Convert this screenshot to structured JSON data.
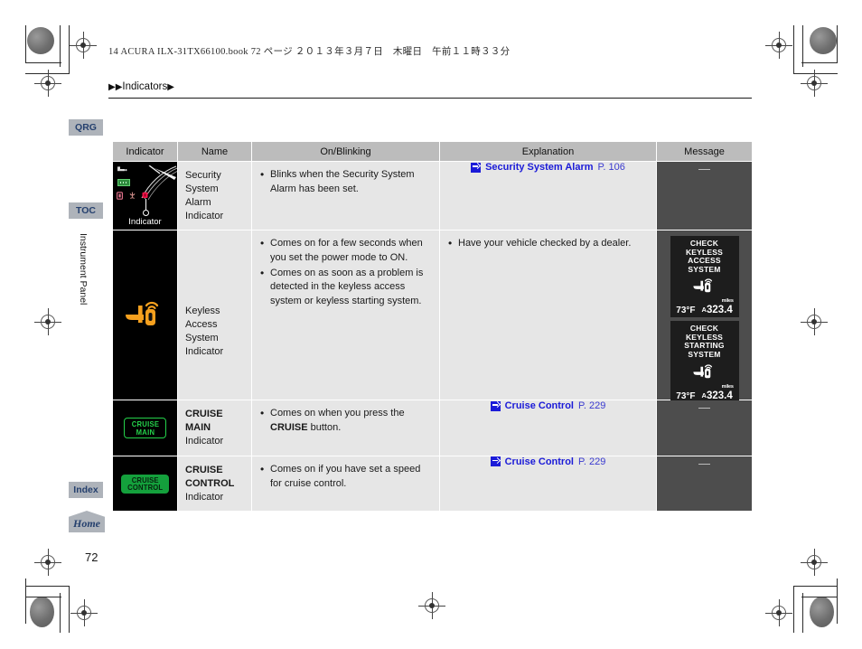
{
  "header": {
    "book_line": "14 ACURA  ILX-31TX66100.book   72 ページ   ２０１３年３月７日　木曜日　午前１１時３３分",
    "breadcrumb": "Indicators",
    "breadcrumb_prefix": "▶▶",
    "breadcrumb_suffix": "▶"
  },
  "sidebar": {
    "tabs": [
      {
        "label": "QRG"
      },
      {
        "label": "TOC"
      },
      {
        "label": "Index"
      }
    ],
    "home_label": "Home",
    "section_label": "Instrument Panel"
  },
  "page": {
    "number": "72"
  },
  "colors": {
    "header_bg": "#bcbcbc",
    "cell_bg": "#e6e6e6",
    "message_bg": "#4d4d4d",
    "link_blue": "#1b1bd8",
    "tab_bg": "#aeb3ba",
    "tab_text": "#25406e",
    "indicator_orange": "#f5a01e",
    "cruise_green": "#24d14a"
  },
  "table": {
    "columns": [
      "Indicator",
      "Name",
      "On/Blinking",
      "Explanation",
      "Message"
    ],
    "rows": [
      {
        "indicator_icon": "security-system-alarm-indicator-icon",
        "indicator_caption": "Indicator",
        "name": "Security System\nAlarm Indicator",
        "name_line1": "Security System",
        "name_line2": "Alarm Indicator",
        "name_bold": false,
        "on_blinking": [
          "Blinks when the Security System Alarm has been set."
        ],
        "explanation": [],
        "explanation_ref": {
          "title": "Security System Alarm",
          "page": "P. 106"
        },
        "message": "—"
      },
      {
        "indicator_icon": "keyless-access-system-indicator-icon",
        "indicator_caption": "",
        "name_line1": "Keyless Access",
        "name_line2": "System Indicator",
        "name_bold": false,
        "on_blinking": [
          "Comes on for a few seconds when you set the power mode to ON.",
          "Comes on as soon as a problem is detected in the keyless access system or keyless starting system."
        ],
        "explanation": [
          "Have your vehicle checked by a dealer."
        ],
        "explanation_ref": null,
        "message_panels": [
          {
            "lines": [
              "CHECK",
              "KEYLESS",
              "ACCESS",
              "SYSTEM"
            ],
            "icon": "keyless-access-system-indicator-icon",
            "temp": "73°F",
            "odometer_prefix": "A",
            "odometer": "323.4",
            "unit": "miles"
          },
          {
            "lines": [
              "CHECK",
              "KEYLESS",
              "STARTING",
              "SYSTEM"
            ],
            "icon": "keyless-access-system-indicator-icon",
            "temp": "73°F",
            "odometer_prefix": "A",
            "odometer": "323.4",
            "unit": "miles"
          }
        ]
      },
      {
        "indicator_icon": "cruise-main-badge",
        "badge_lines": [
          "CRUISE",
          "MAIN"
        ],
        "name_line1": "CRUISE MAIN",
        "name_line2": "Indicator",
        "name_bold": true,
        "on_blinking_html": "Comes on when you press the <b>CRUISE</b> button.",
        "explanation": [],
        "explanation_ref": {
          "title": "Cruise Control",
          "page": "P. 229"
        },
        "message": "—"
      },
      {
        "indicator_icon": "cruise-control-badge",
        "badge_lines": [
          "CRUISE",
          "CONTROL"
        ],
        "name_line1": "CRUISE",
        "name_line2": "CONTROL",
        "name_line3": "Indicator",
        "name_bold": true,
        "on_blinking": [
          "Comes on if you have set a speed for cruise control."
        ],
        "explanation": [],
        "explanation_ref": {
          "title": "Cruise Control",
          "page": "P. 229"
        },
        "message": "—"
      }
    ]
  }
}
